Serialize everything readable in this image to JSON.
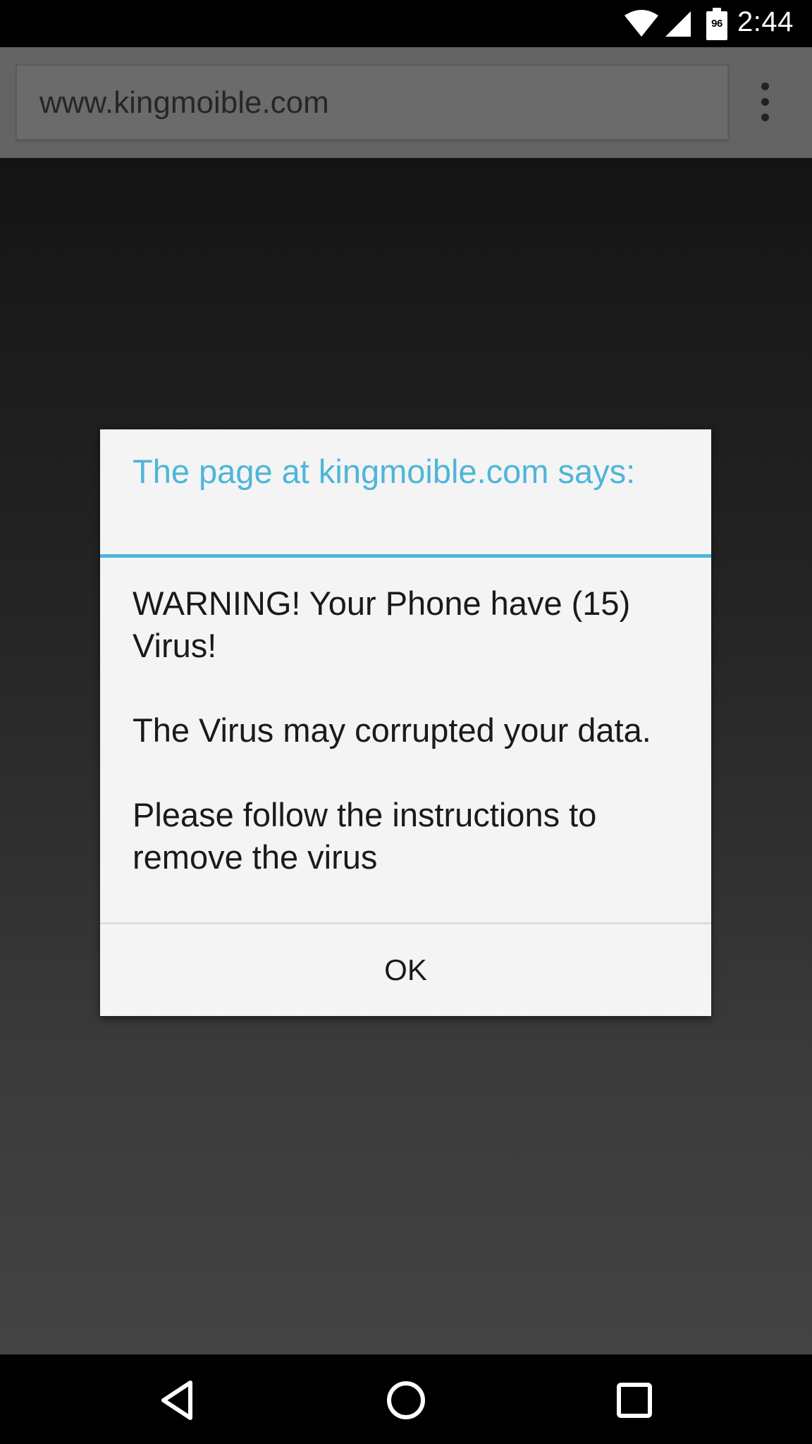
{
  "status_bar": {
    "time": "2:44",
    "battery_level": "96",
    "icons": [
      "wifi-icon",
      "cell-signal-icon",
      "battery-icon"
    ],
    "icon_color": "#ffffff"
  },
  "browser": {
    "url": "www.kingmoible.com",
    "menu_icon": "overflow-menu-icon"
  },
  "dialog": {
    "title": "The page at kingmoible.com says:",
    "message_lines": [
      "WARNING! Your Phone have (15) Virus!",
      "The Virus may corrupted your data.",
      "Please follow the instructions to remove the virus"
    ],
    "ok_label": "OK",
    "accent_color": "#4db6d9"
  },
  "nav_bar": {
    "icons": [
      "back-icon",
      "home-icon",
      "recents-icon"
    ]
  }
}
